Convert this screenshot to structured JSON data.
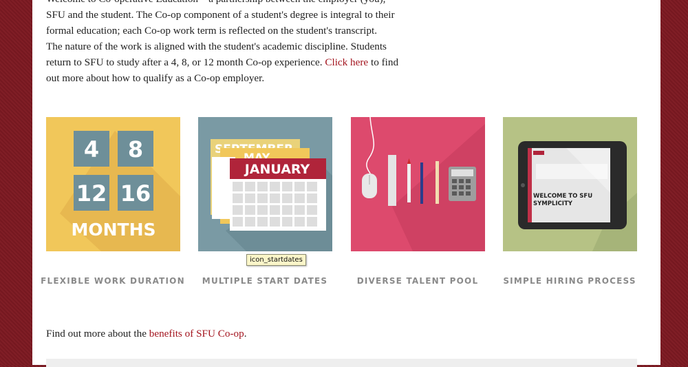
{
  "intro": {
    "line1": "Welcome to Co-operative Education – a partnership between the employer (you),",
    "line2": "SFU and the student.  The Co-op component of a student's degree is integral to their",
    "line3": "formal education; each Co-op work term is reflected on the student's transcript.",
    "line4": "The nature of the work is aligned with the student's academic discipline.  Students",
    "line5_before": "return to SFU to study after a 4, 8, or 12 month Co-op experience. ",
    "line5_link": "Click here",
    "line5_after": " to find",
    "line6": "out more about how to qualify as a Co-op employer."
  },
  "tiles": [
    {
      "caption": "FLEXIBLE WORK DURATION",
      "color": "#f1c75a",
      "numbers": [
        "4",
        "8",
        "12",
        "16"
      ],
      "label": "MONTHS"
    },
    {
      "caption": "MULTIPLE START DATES",
      "color": "#7a9aa4",
      "months": [
        "SEPTEMBER",
        "MAY",
        "JANUARY"
      ]
    },
    {
      "caption": "DIVERSE TALENT POOL",
      "color": "#dd4a6d"
    },
    {
      "caption": "SIMPLE HIRING PROCESS",
      "color": "#b6c285",
      "screen_text_1": "WELCOME TO SFU",
      "screen_text_2": "SYMPLICITY"
    }
  ],
  "tooltip": "icon_startdates",
  "outro": {
    "before": "Find out more about the ",
    "link": "benefits of SFU Co-op",
    "after": "."
  },
  "colors": {
    "link": "#a3141e",
    "background": "#7d1a22"
  }
}
